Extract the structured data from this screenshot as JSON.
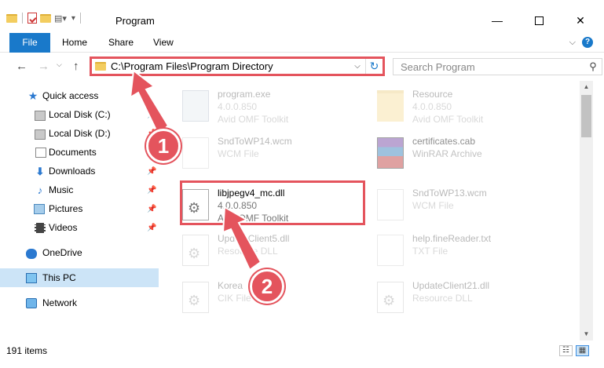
{
  "window": {
    "title": "Program",
    "minimize": "—",
    "close": "✕"
  },
  "ribbon": {
    "tabs": [
      "File",
      "Home",
      "Share",
      "View"
    ],
    "collapse": "⌵",
    "help": "?"
  },
  "nav": {
    "back": "←",
    "forward": "→",
    "recent": "⌵",
    "up": "↑",
    "address": "C:\\Program Files\\Program Directory",
    "address_dropdown": "⌵",
    "refresh": "↻",
    "search_placeholder": "Search Program",
    "search_icon": "⚲"
  },
  "sidebar": {
    "items": [
      {
        "label": "Quick access",
        "icon": "star-icon",
        "pinned": false
      },
      {
        "label": "Local Disk (C:)",
        "icon": "disk-icon",
        "pinned": true
      },
      {
        "label": "Local Disk (D:)",
        "icon": "disk-icon",
        "pinned": true
      },
      {
        "label": "Documents",
        "icon": "documents-icon",
        "pinned": true
      },
      {
        "label": "Downloads",
        "icon": "download-icon",
        "pinned": true
      },
      {
        "label": "Music",
        "icon": "music-icon",
        "pinned": true
      },
      {
        "label": "Pictures",
        "icon": "pictures-icon",
        "pinned": true
      },
      {
        "label": "Videos",
        "icon": "videos-icon",
        "pinned": true
      },
      {
        "label": "OneDrive",
        "icon": "cloud-icon",
        "pinned": false
      },
      {
        "label": "This PC",
        "icon": "computer-icon",
        "pinned": false,
        "selected": true
      },
      {
        "label": "Network",
        "icon": "network-icon",
        "pinned": false
      }
    ],
    "pin_glyph": "📌"
  },
  "files": [
    {
      "name": "program.exe",
      "line2": "4.0.0.850",
      "line3": "Avid OMF Toolkit",
      "icon": "exe-icon"
    },
    {
      "name": "Resource",
      "line2": "4.0.0.850",
      "line3": "Avid OMF Toolkit",
      "icon": "folder-icon"
    },
    {
      "name": "SndToWP14.wcm",
      "line2": "WCM File",
      "line3": "",
      "icon": "document-icon"
    },
    {
      "name": "certificates.cab",
      "line2": "WinRAR Archive",
      "line3": "",
      "icon": "winrar-icon"
    },
    {
      "name": "libjpegv4_mc.dll",
      "line2": "4.0.0.850",
      "line3": "Avid OMF Toolkit",
      "icon": "dll-icon",
      "highlighted": true
    },
    {
      "name": "SndToWP13.wcm",
      "line2": "WCM File",
      "line3": "",
      "icon": "document-icon"
    },
    {
      "name": "UpdateClient5.dll",
      "line2": "Resource DLL",
      "line3": "",
      "icon": "dll-icon"
    },
    {
      "name": "help.fineReader.txt",
      "line2": "TXT File",
      "line3": "",
      "icon": "document-icon"
    },
    {
      "name": "Korea",
      "line2": "CIK File",
      "line3": "",
      "icon": "dll-icon"
    },
    {
      "name": "UpdateClient21.dll",
      "line2": "Resource DLL",
      "line3": "",
      "icon": "dll-icon"
    }
  ],
  "statusbar": {
    "count": "191 items"
  },
  "callouts": [
    {
      "number": "1",
      "color": "#e4545d"
    },
    {
      "number": "2",
      "color": "#e4545d"
    }
  ],
  "colors": {
    "accent": "#1979ca",
    "highlight": "#e4545d",
    "selection": "#cce4f7"
  }
}
